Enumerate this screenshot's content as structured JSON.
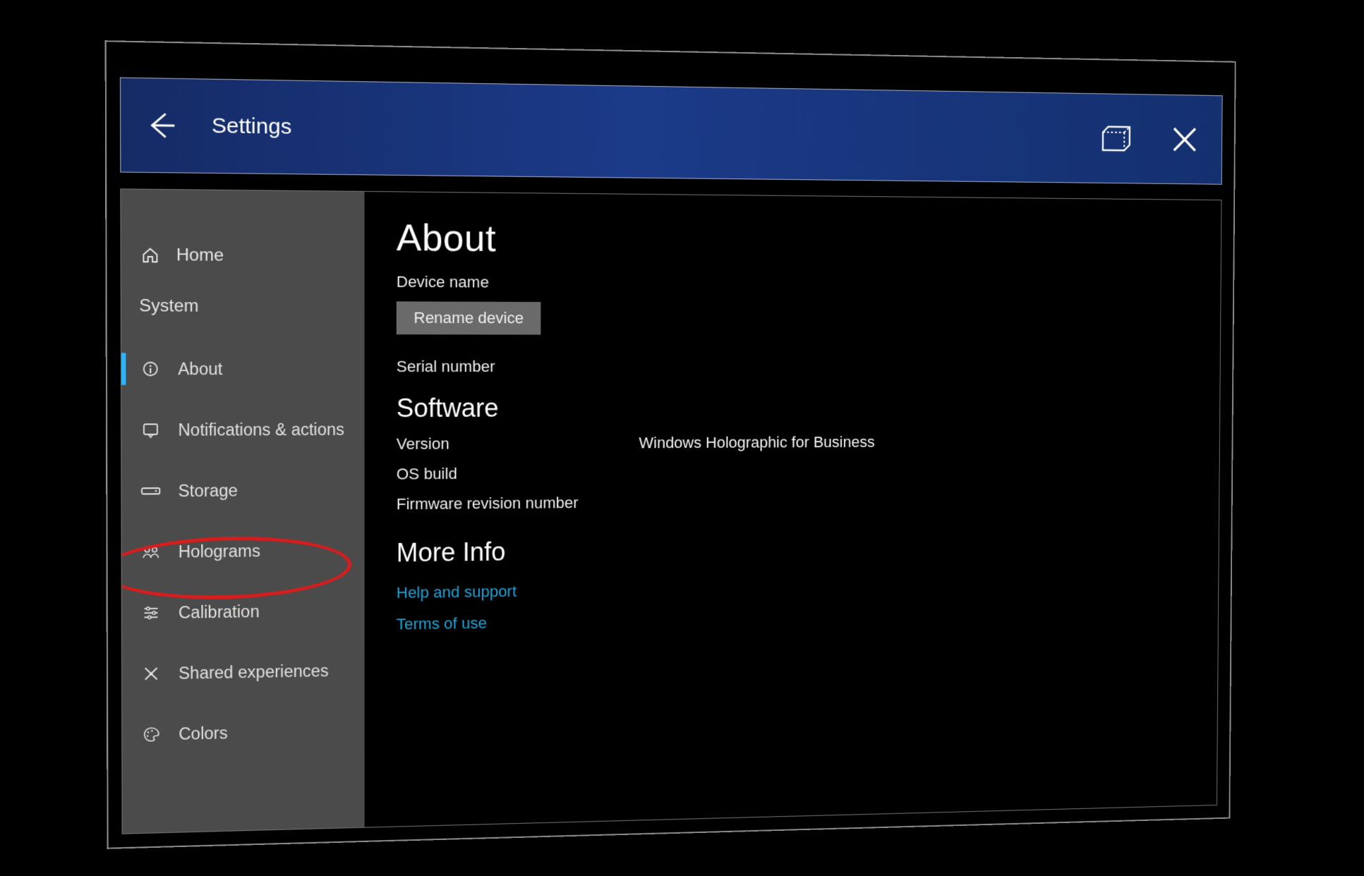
{
  "titlebar": {
    "title": "Settings"
  },
  "sidebar": {
    "home_label": "Home",
    "section_label": "System",
    "items": [
      {
        "label": "About",
        "icon": "info-icon",
        "active": true
      },
      {
        "label": "Notifications & actions",
        "icon": "notification-icon",
        "active": false
      },
      {
        "label": "Storage",
        "icon": "storage-icon",
        "active": false
      },
      {
        "label": "Holograms",
        "icon": "holograms-icon",
        "active": false
      },
      {
        "label": "Calibration",
        "icon": "calibration-icon",
        "active": false
      },
      {
        "label": "Shared experiences",
        "icon": "shared-icon",
        "active": false
      },
      {
        "label": "Colors",
        "icon": "colors-icon",
        "active": false
      }
    ]
  },
  "main": {
    "heading": "About",
    "device_name_label": "Device name",
    "rename_button": "Rename device",
    "serial_label": "Serial number",
    "software_heading": "Software",
    "version_label": "Version",
    "version_value": "Windows Holographic for Business",
    "os_build_label": "OS build",
    "firmware_label": "Firmware revision number",
    "more_info_heading": "More Info",
    "help_link": "Help and support",
    "terms_link": "Terms of use"
  }
}
